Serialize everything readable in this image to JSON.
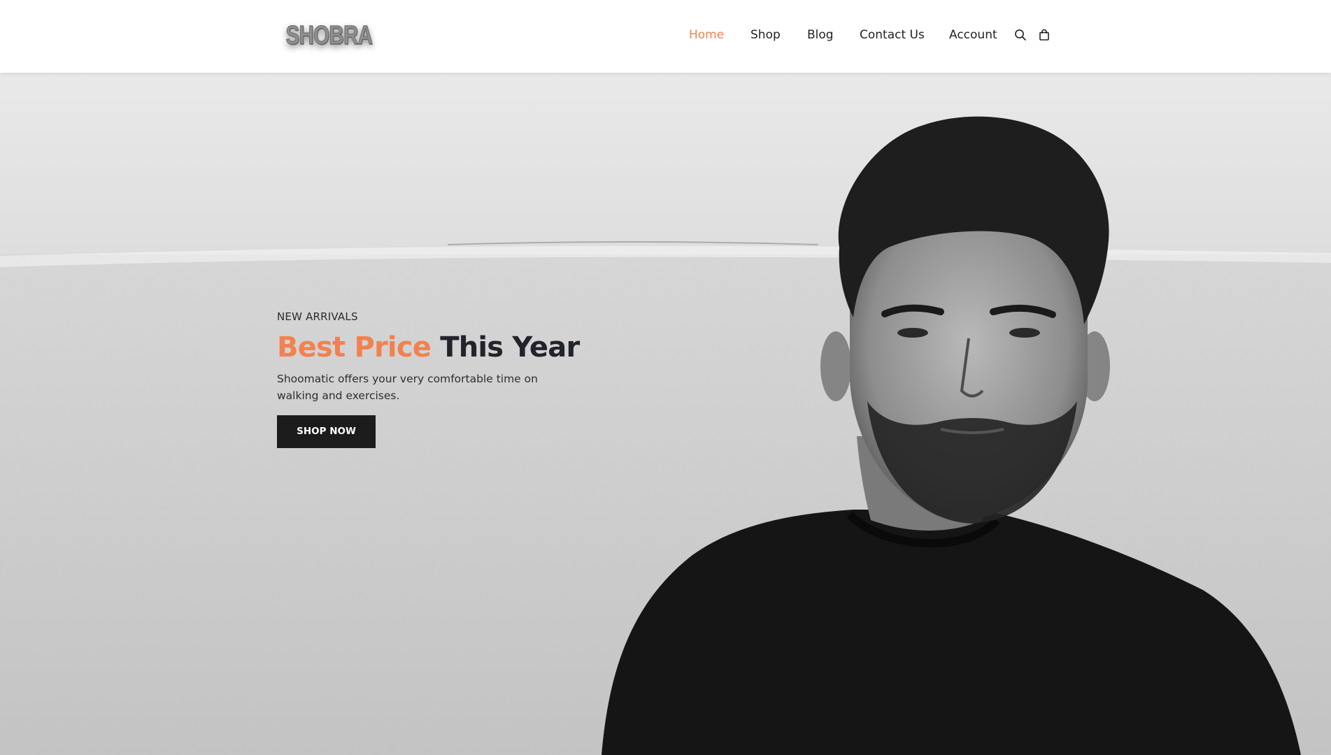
{
  "brand": {
    "logo_text": "SHOBRA"
  },
  "nav": {
    "items": [
      {
        "label": "Home",
        "active": true
      },
      {
        "label": "Shop",
        "active": false
      },
      {
        "label": "Blog",
        "active": false
      },
      {
        "label": "Contact Us",
        "active": false
      },
      {
        "label": "Account",
        "active": false
      }
    ],
    "icons": [
      "search-icon",
      "shopping-bag-icon"
    ]
  },
  "hero": {
    "eyebrow": "NEW ARRIVALS",
    "headline_accent": "Best Price",
    "headline_rest": "This Year",
    "subtext": "Shoomatic offers your very comfortable time on walking and exercises.",
    "cta_label": "SHOP NOW",
    "image": "hero-photo-man-black-tshirt"
  },
  "colors": {
    "accent": "#f3814f",
    "dark": "#1c1c1c",
    "header_bg": "#ffffff"
  }
}
